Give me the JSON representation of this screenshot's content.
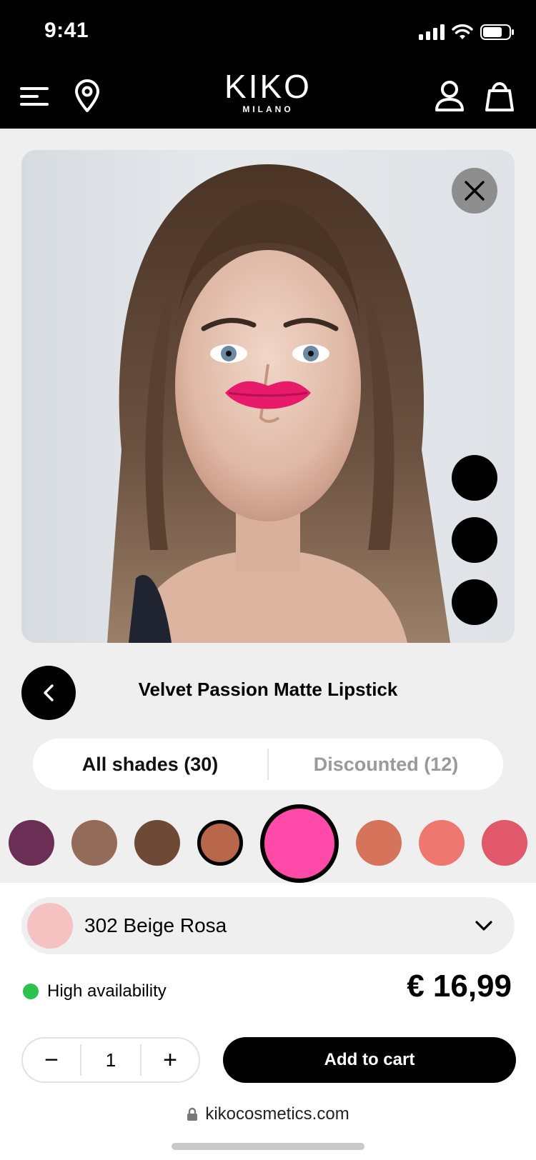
{
  "status": {
    "time": "9:41"
  },
  "header": {
    "brand": "KIKO",
    "brand_sub": "MILANO"
  },
  "product": {
    "title": "Velvet Passion Matte Lipstick"
  },
  "filters": {
    "all_label": "All shades (30)",
    "discounted_label": "Discounted (12)"
  },
  "swatches": [
    {
      "color": "#6b2f56"
    },
    {
      "color": "#946a58"
    },
    {
      "color": "#6e4a36"
    },
    {
      "color": "#b9674a",
      "selected_ring": true
    },
    {
      "color": "#ff4aaa",
      "active": true
    },
    {
      "color": "#d5745a"
    },
    {
      "color": "#ee7770"
    },
    {
      "color": "#e0586a"
    }
  ],
  "selected_shade": {
    "name": "302 Beige Rosa",
    "color": "#f5c2c2"
  },
  "availability": {
    "label": "High availability",
    "color": "#2bc24d"
  },
  "price": "€ 16,99",
  "quantity": {
    "value": "1",
    "minus": "−",
    "plus": "+"
  },
  "cart": {
    "label": "Add to cart"
  },
  "browser": {
    "url": "kikocosmetics.com"
  }
}
